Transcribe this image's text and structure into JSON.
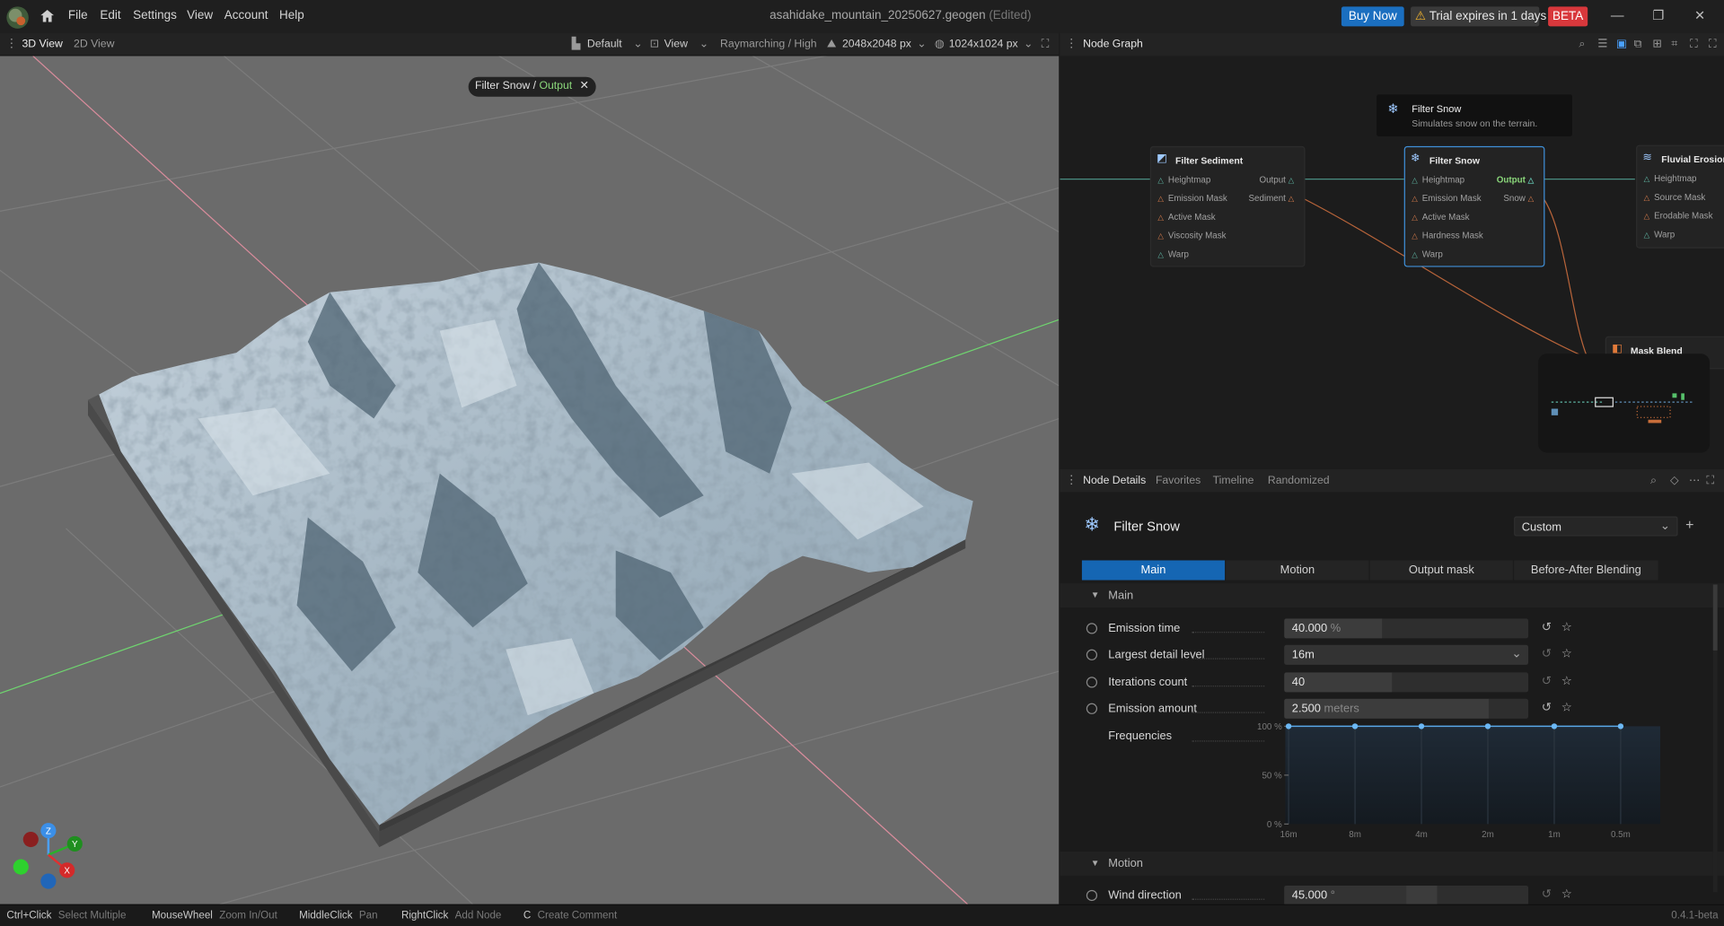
{
  "menu": [
    "File",
    "Edit",
    "Settings",
    "View",
    "Account",
    "Help"
  ],
  "title": {
    "file": "asahidake_mountain_20250627.geogen",
    "edited": "(Edited)"
  },
  "buy_now": "Buy Now",
  "trial": "Trial expires in 1 days",
  "beta": "BETA",
  "viewport_tabs": [
    "3D View",
    "2D View"
  ],
  "viewport_toolbar": {
    "preset": "Default",
    "view": "View",
    "render": "Raymarching / High",
    "resolution": "2048x2048 px",
    "preview": "1024x1024 px"
  },
  "crumb": {
    "node": "Filter Snow",
    "sep": " / ",
    "output": "Output"
  },
  "axes": {
    "z": "Z",
    "y": "Y",
    "x": "X"
  },
  "node_graph": {
    "title": "Node Graph",
    "tooltip": {
      "title": "Filter Snow",
      "desc": "Simulates snow on the terrain."
    },
    "nodes": [
      {
        "title": "Filter Sediment",
        "inputs": [
          "Heightmap",
          "Emission Mask",
          "Active Mask",
          "Viscosity Mask",
          "Warp"
        ],
        "outputs": [
          "Output",
          "Sediment"
        ]
      },
      {
        "title": "Filter Snow",
        "inputs": [
          "Heightmap",
          "Emission Mask",
          "Active Mask",
          "Hardness Mask",
          "Warp"
        ],
        "outputs": [
          "Output",
          "Snow"
        ]
      },
      {
        "title": "Fluvial Erosion",
        "inputs": [
          "Heightmap",
          "Source Mask",
          "Erodable Mask",
          "Warp"
        ],
        "outputs": []
      },
      {
        "title": "Mask Blend",
        "inputs": [],
        "outputs": []
      }
    ]
  },
  "node_details": {
    "tabs": [
      "Node Details",
      "Favorites",
      "Timeline",
      "Randomized"
    ],
    "node_title": "Filter Snow",
    "preset": "Custom",
    "subtabs": [
      "Main",
      "Motion",
      "Output mask",
      "Before-After Blending"
    ],
    "sections": {
      "main": "Main",
      "motion": "Motion"
    },
    "params": [
      {
        "label": "Emission time",
        "value": "40.000",
        "unit": "%",
        "fill": 0.4
      },
      {
        "label": "Largest detail level",
        "value": "16m",
        "unit": "",
        "fill": 0
      },
      {
        "label": "Iterations count",
        "value": "40",
        "unit": "",
        "fill": 0.44
      },
      {
        "label": "Emission amount",
        "value": "2.500",
        "unit": "meters",
        "fill": 0.84
      }
    ],
    "frequencies": {
      "label": "Frequencies",
      "y_ticks": [
        "100 %",
        "50 %",
        "0 %"
      ],
      "x_ticks": [
        "16m",
        "8m",
        "4m",
        "2m",
        "1m",
        "0.5m"
      ],
      "values": [
        100,
        100,
        100,
        100,
        100,
        100
      ]
    },
    "wind": {
      "label": "Wind direction",
      "value": "45.000",
      "unit": "°",
      "fill": 0.5
    }
  },
  "status": [
    {
      "key": "Ctrl+Click",
      "desc": "Select Multiple"
    },
    {
      "key": "MouseWheel",
      "desc": "Zoom In/Out"
    },
    {
      "key": "MiddleClick",
      "desc": "Pan"
    },
    {
      "key": "RightClick",
      "desc": "Add Node"
    },
    {
      "key": "C",
      "desc": "Create Comment"
    }
  ],
  "version": "0.4.1-beta"
}
